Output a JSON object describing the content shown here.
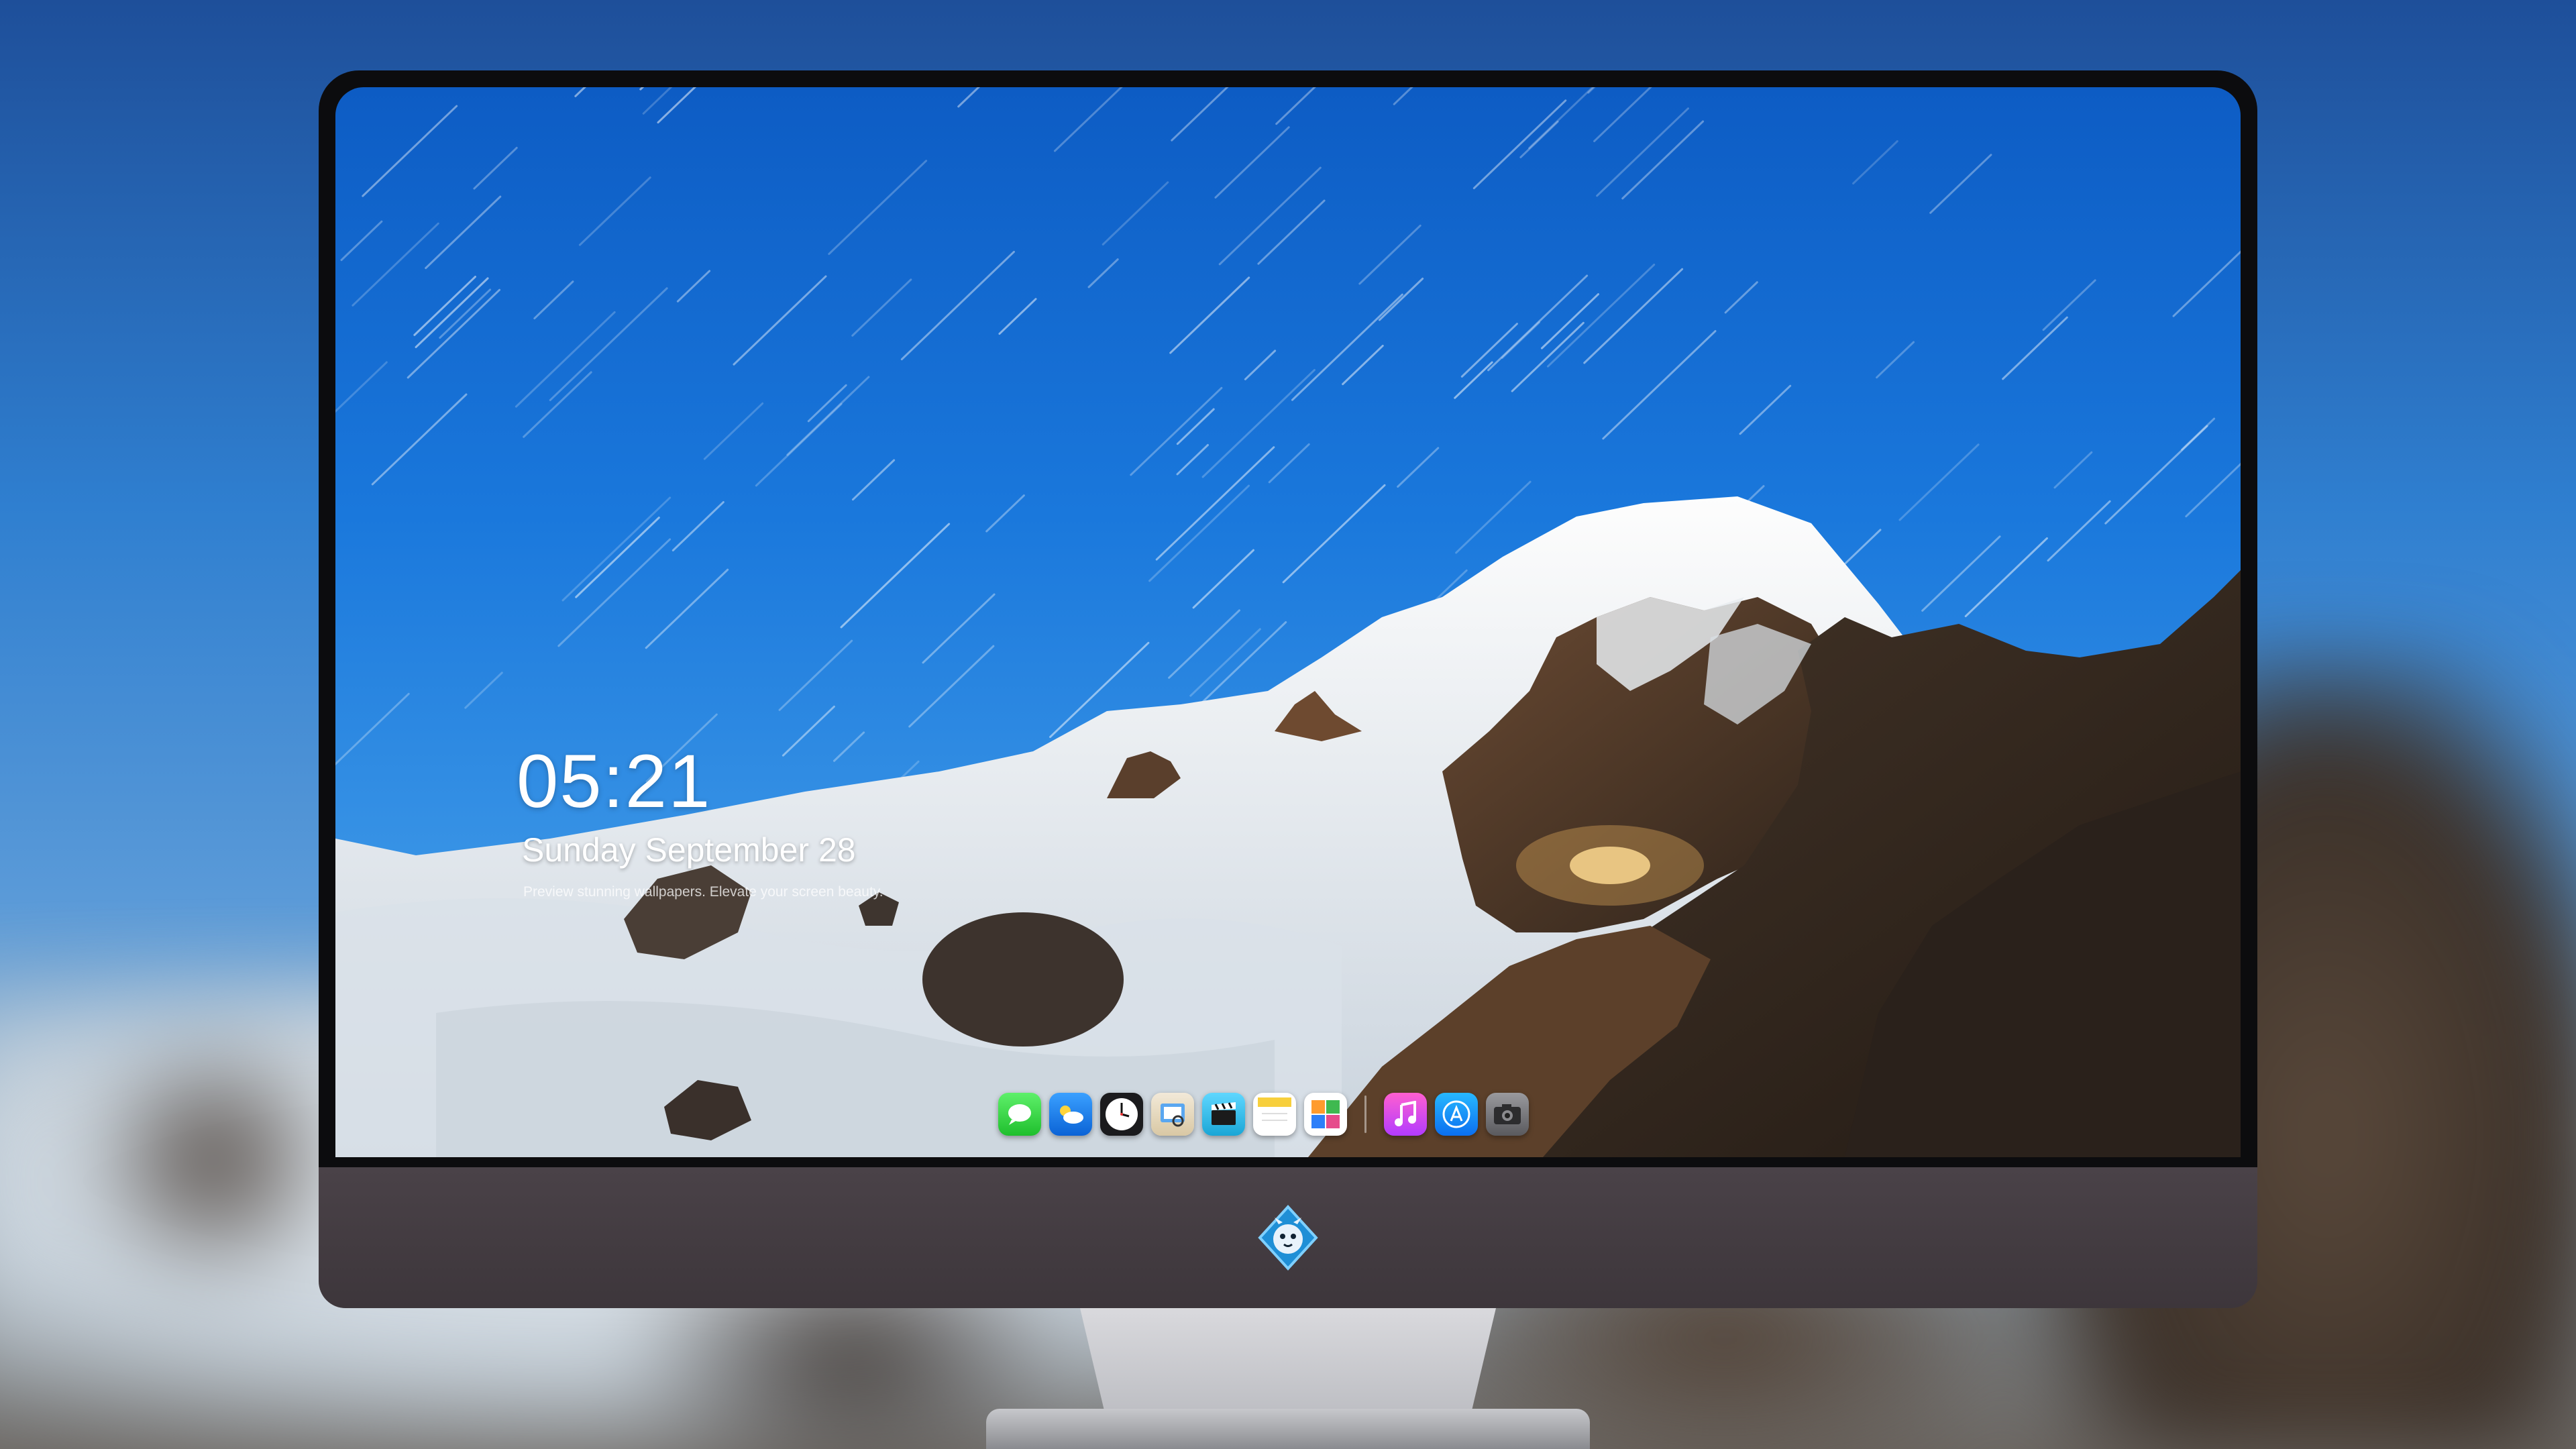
{
  "lock_screen": {
    "time": "05:21",
    "date": "Sunday September  28",
    "promo": "Preview stunning wallpapers. Elevate your screen beauty."
  },
  "dock": {
    "apps": [
      "messages",
      "weather",
      "clock",
      "preview",
      "final-cut",
      "notes",
      "photos"
    ],
    "pinned": [
      "music",
      "app-store",
      "camera"
    ]
  },
  "colors": {
    "sky": "#1a78dc",
    "bezel": "#0c0c0e",
    "chin": "#4a4248"
  }
}
